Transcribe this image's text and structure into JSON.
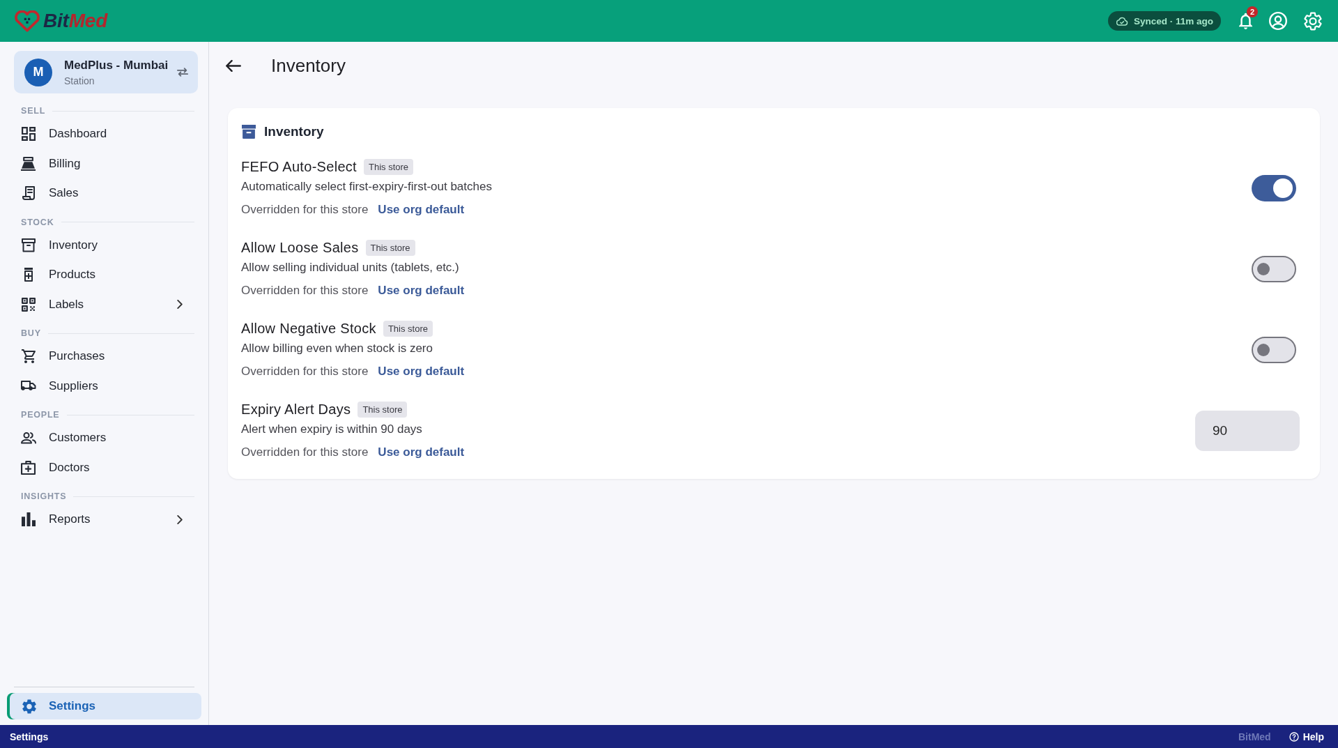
{
  "top_bar": {
    "logo": [
      "Bit",
      "Med"
    ],
    "sync_status": "Synced · 11m ago",
    "notification_count": "2"
  },
  "sidebar": {
    "station": {
      "avatar": "M",
      "name": "MedPlus - Mumbai",
      "role": "Station"
    },
    "sections": [
      {
        "heading": "SELL",
        "items": [
          {
            "label": "Dashboard",
            "submenu": false,
            "selected": false
          },
          {
            "label": "Billing",
            "submenu": false,
            "selected": false
          },
          {
            "label": "Sales",
            "submenu": false,
            "selected": false
          }
        ]
      },
      {
        "heading": "STOCK",
        "items": [
          {
            "label": "Inventory",
            "submenu": false,
            "selected": false
          },
          {
            "label": "Products",
            "submenu": false,
            "selected": false
          },
          {
            "label": "Labels",
            "submenu": true,
            "selected": false
          }
        ]
      },
      {
        "heading": "BUY",
        "items": [
          {
            "label": "Purchases",
            "submenu": false,
            "selected": false
          },
          {
            "label": "Suppliers",
            "submenu": false,
            "selected": false
          }
        ]
      },
      {
        "heading": "PEOPLE",
        "items": [
          {
            "label": "Customers",
            "submenu": false,
            "selected": false
          },
          {
            "label": "Doctors",
            "submenu": false,
            "selected": false
          }
        ]
      },
      {
        "heading": "INSIGHTS",
        "items": [
          {
            "label": "Reports",
            "submenu": true,
            "selected": false
          }
        ]
      }
    ],
    "footer_items": [
      {
        "label": "Settings",
        "selected": true
      }
    ]
  },
  "main": {
    "page_title": "Inventory",
    "card": {
      "title": "Inventory",
      "settings": [
        {
          "kind": "toggle",
          "title": "FEFO Auto-Select",
          "badge": "This store",
          "description": "Automatically select first-expiry-first-out batches",
          "override_note": "Overridden for this store",
          "reset_link": "Use org default",
          "on": true
        },
        {
          "kind": "toggle",
          "title": "Allow Loose Sales",
          "badge": "This store",
          "description": "Allow selling individual units (tablets, etc.)",
          "override_note": "Overridden for this store",
          "reset_link": "Use org default",
          "on": false
        },
        {
          "kind": "toggle",
          "title": "Allow Negative Stock",
          "badge": "This store",
          "description": "Allow billing even when stock is zero",
          "override_note": "Overridden for this store",
          "reset_link": "Use org default",
          "on": false
        },
        {
          "kind": "number",
          "title": "Expiry Alert Days",
          "badge": "This store",
          "description": "Alert when expiry is within 90 days",
          "override_note": "Overridden for this store",
          "reset_link": "Use org default",
          "value": "90"
        }
      ]
    }
  },
  "status_bar": {
    "section": "Settings",
    "brand": "BitMed",
    "help": "Help"
  }
}
